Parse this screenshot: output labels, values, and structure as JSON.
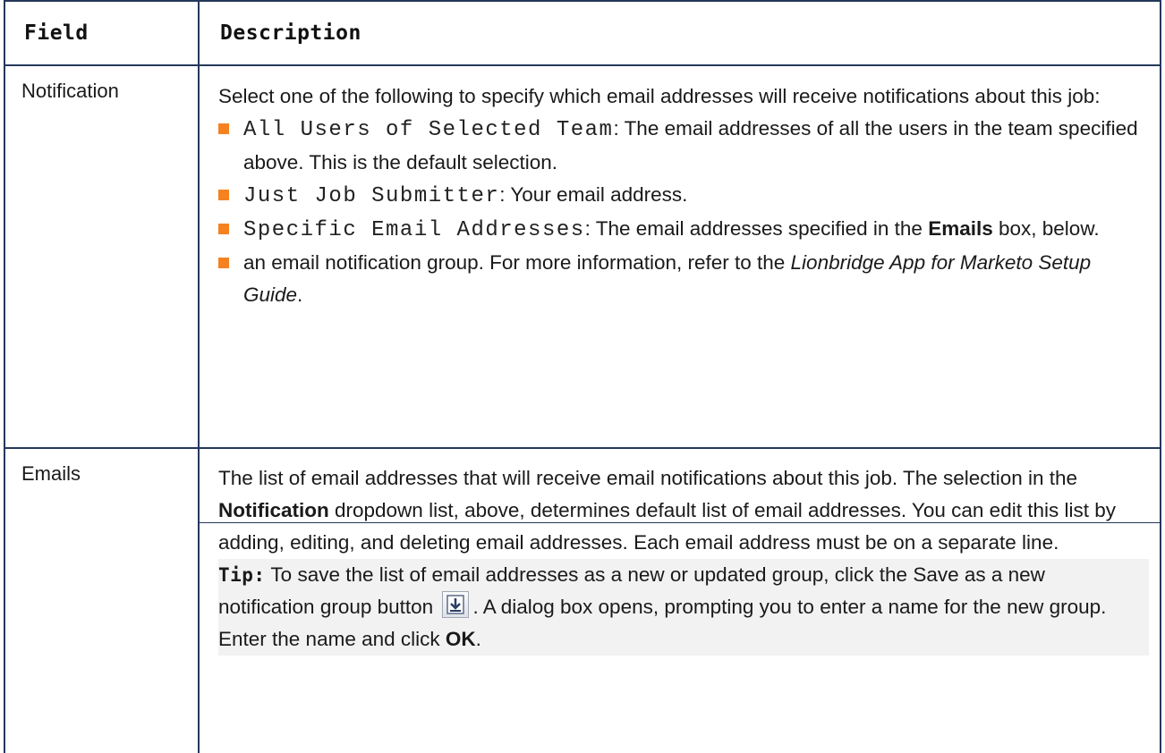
{
  "table": {
    "headers": {
      "field": "Field",
      "description": "Description"
    },
    "rows": [
      {
        "field": "Notification",
        "intro": "Select one of the following to specify which email addresses will receive notifications about this job:",
        "options": [
          {
            "code": "All Users of Selected Team",
            "text": ": The email addresses of all the users in the team specified above. This is the default selection."
          },
          {
            "code": "Just Job Submitter",
            "text": ": Your email address."
          },
          {
            "code": "Specific Email Addresses",
            "text_before": ": The email addresses specified in the ",
            "bold": "Emails",
            "text_after": " box, below."
          },
          {
            "text_before": "an email notification group. For more information, refer to the ",
            "italic": "Lionbridge App for Marketo Setup Guide",
            "text_after": "."
          }
        ]
      },
      {
        "field": "Emails",
        "para_before": "The list of email addresses that will receive email notifications about this job. The selection in the ",
        "para_bold": "Notification",
        "para_after": " dropdown list, above, determines default list of email addresses. You can edit this list by adding, editing, and deleting email addresses. Each email address must be on a separate line.",
        "tip_label": "Tip:",
        "tip_part1": " To save the list of email addresses as a new or updated group, click the Save as a new notification group button ",
        "tip_icon": "save-to-group-icon",
        "tip_part2": ". A dialog box opens, prompting you to enter a name for the new group. Enter the name and click ",
        "tip_bold": "OK",
        "tip_end": "."
      }
    ]
  },
  "colors": {
    "border": "#24385b",
    "bullet": "#f58220",
    "tip_background": "#f2f2f2"
  }
}
